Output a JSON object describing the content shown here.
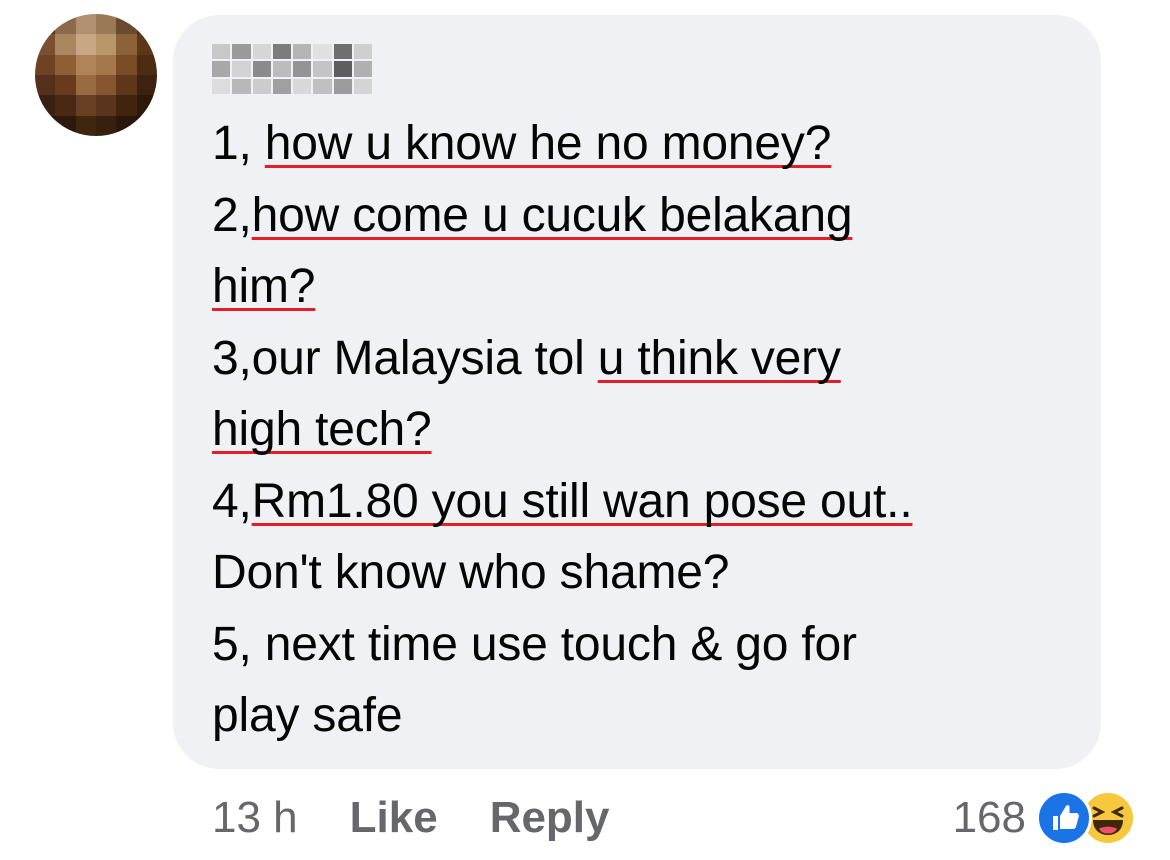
{
  "comment": {
    "author_name": "",
    "lines": [
      [
        "1, ",
        "how u know he no money?"
      ],
      [
        "2,",
        "how come u cucuk belakang"
      ],
      [
        "",
        "him?"
      ],
      [
        "3,our Malaysia tol ",
        "u think very"
      ],
      [
        "",
        "high tech?"
      ],
      [
        "4,",
        "Rm1.80 you still wan pose out.."
      ],
      [
        "Don't know who shame?",
        ""
      ],
      [
        "5, next time use touch & go for",
        ""
      ],
      [
        "play safe",
        ""
      ]
    ],
    "timestamp": "13 h",
    "like_label": "Like",
    "reply_label": "Reply",
    "reaction_count": "168",
    "reactions": [
      "like-icon",
      "haha-icon"
    ]
  },
  "colors": {
    "bubble_bg": "#eff1f5",
    "text": "#050505",
    "meta_text": "#65676b",
    "spellcheck_underline": "#e41e26",
    "like_blue": "#1a74e5",
    "haha_yellow": "#f7c83e"
  }
}
